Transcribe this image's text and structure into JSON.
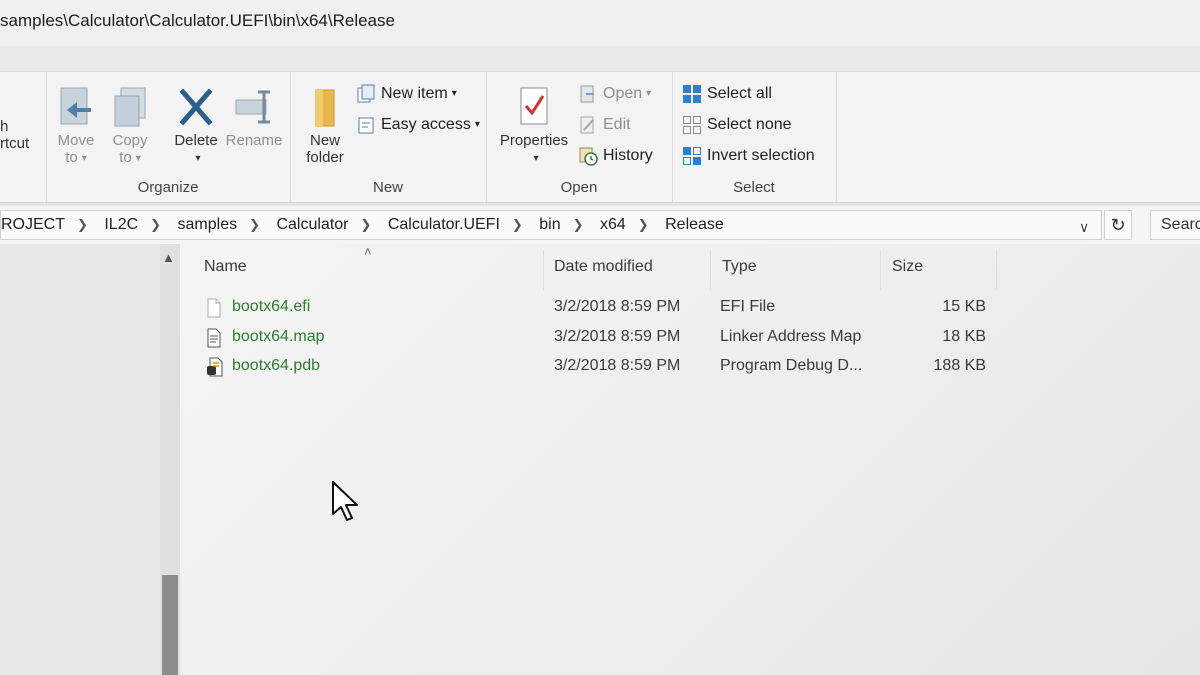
{
  "window": {
    "title": "samples\\Calculator\\Calculator.UEFI\\bin\\x64\\Release"
  },
  "ribbon": {
    "partial_left": {
      "line1": "h",
      "line2": "rtcut"
    },
    "organize": {
      "label": "Organize",
      "move_to": {
        "line1": "Move",
        "line2": "to"
      },
      "copy_to": {
        "line1": "Copy",
        "line2": "to"
      },
      "delete": "Delete",
      "rename": "Rename"
    },
    "new": {
      "label": "New",
      "new_folder": {
        "line1": "New",
        "line2": "folder"
      },
      "new_item": "New item",
      "easy_access": "Easy access"
    },
    "open": {
      "label": "Open",
      "properties": "Properties",
      "open": "Open",
      "edit": "Edit",
      "history": "History"
    },
    "select": {
      "label": "Select",
      "select_all": "Select all",
      "select_none": "Select none",
      "invert_selection": "Invert selection"
    }
  },
  "address": {
    "crumbs": [
      "ROJECT",
      "IL2C",
      "samples",
      "Calculator",
      "Calculator.UEFI",
      "bin",
      "x64",
      "Release"
    ],
    "search_placeholder": "Searc"
  },
  "files": {
    "columns": [
      "Name",
      "Date modified",
      "Type",
      "Size"
    ],
    "rows": [
      {
        "name": "bootx64.efi",
        "date": "3/2/2018 8:59 PM",
        "type": "EFI File",
        "size": "15 KB",
        "icon": "efi-file-icon"
      },
      {
        "name": "bootx64.map",
        "date": "3/2/2018 8:59 PM",
        "type": "Linker Address Map",
        "size": "18 KB",
        "icon": "map-file-icon"
      },
      {
        "name": "bootx64.pdb",
        "date": "3/2/2018 8:59 PM",
        "type": "Program Debug D...",
        "size": "188 KB",
        "icon": "pdb-file-icon"
      }
    ]
  },
  "colors": {
    "name_text": "#2e7d32",
    "accent": "#1e73c8"
  }
}
